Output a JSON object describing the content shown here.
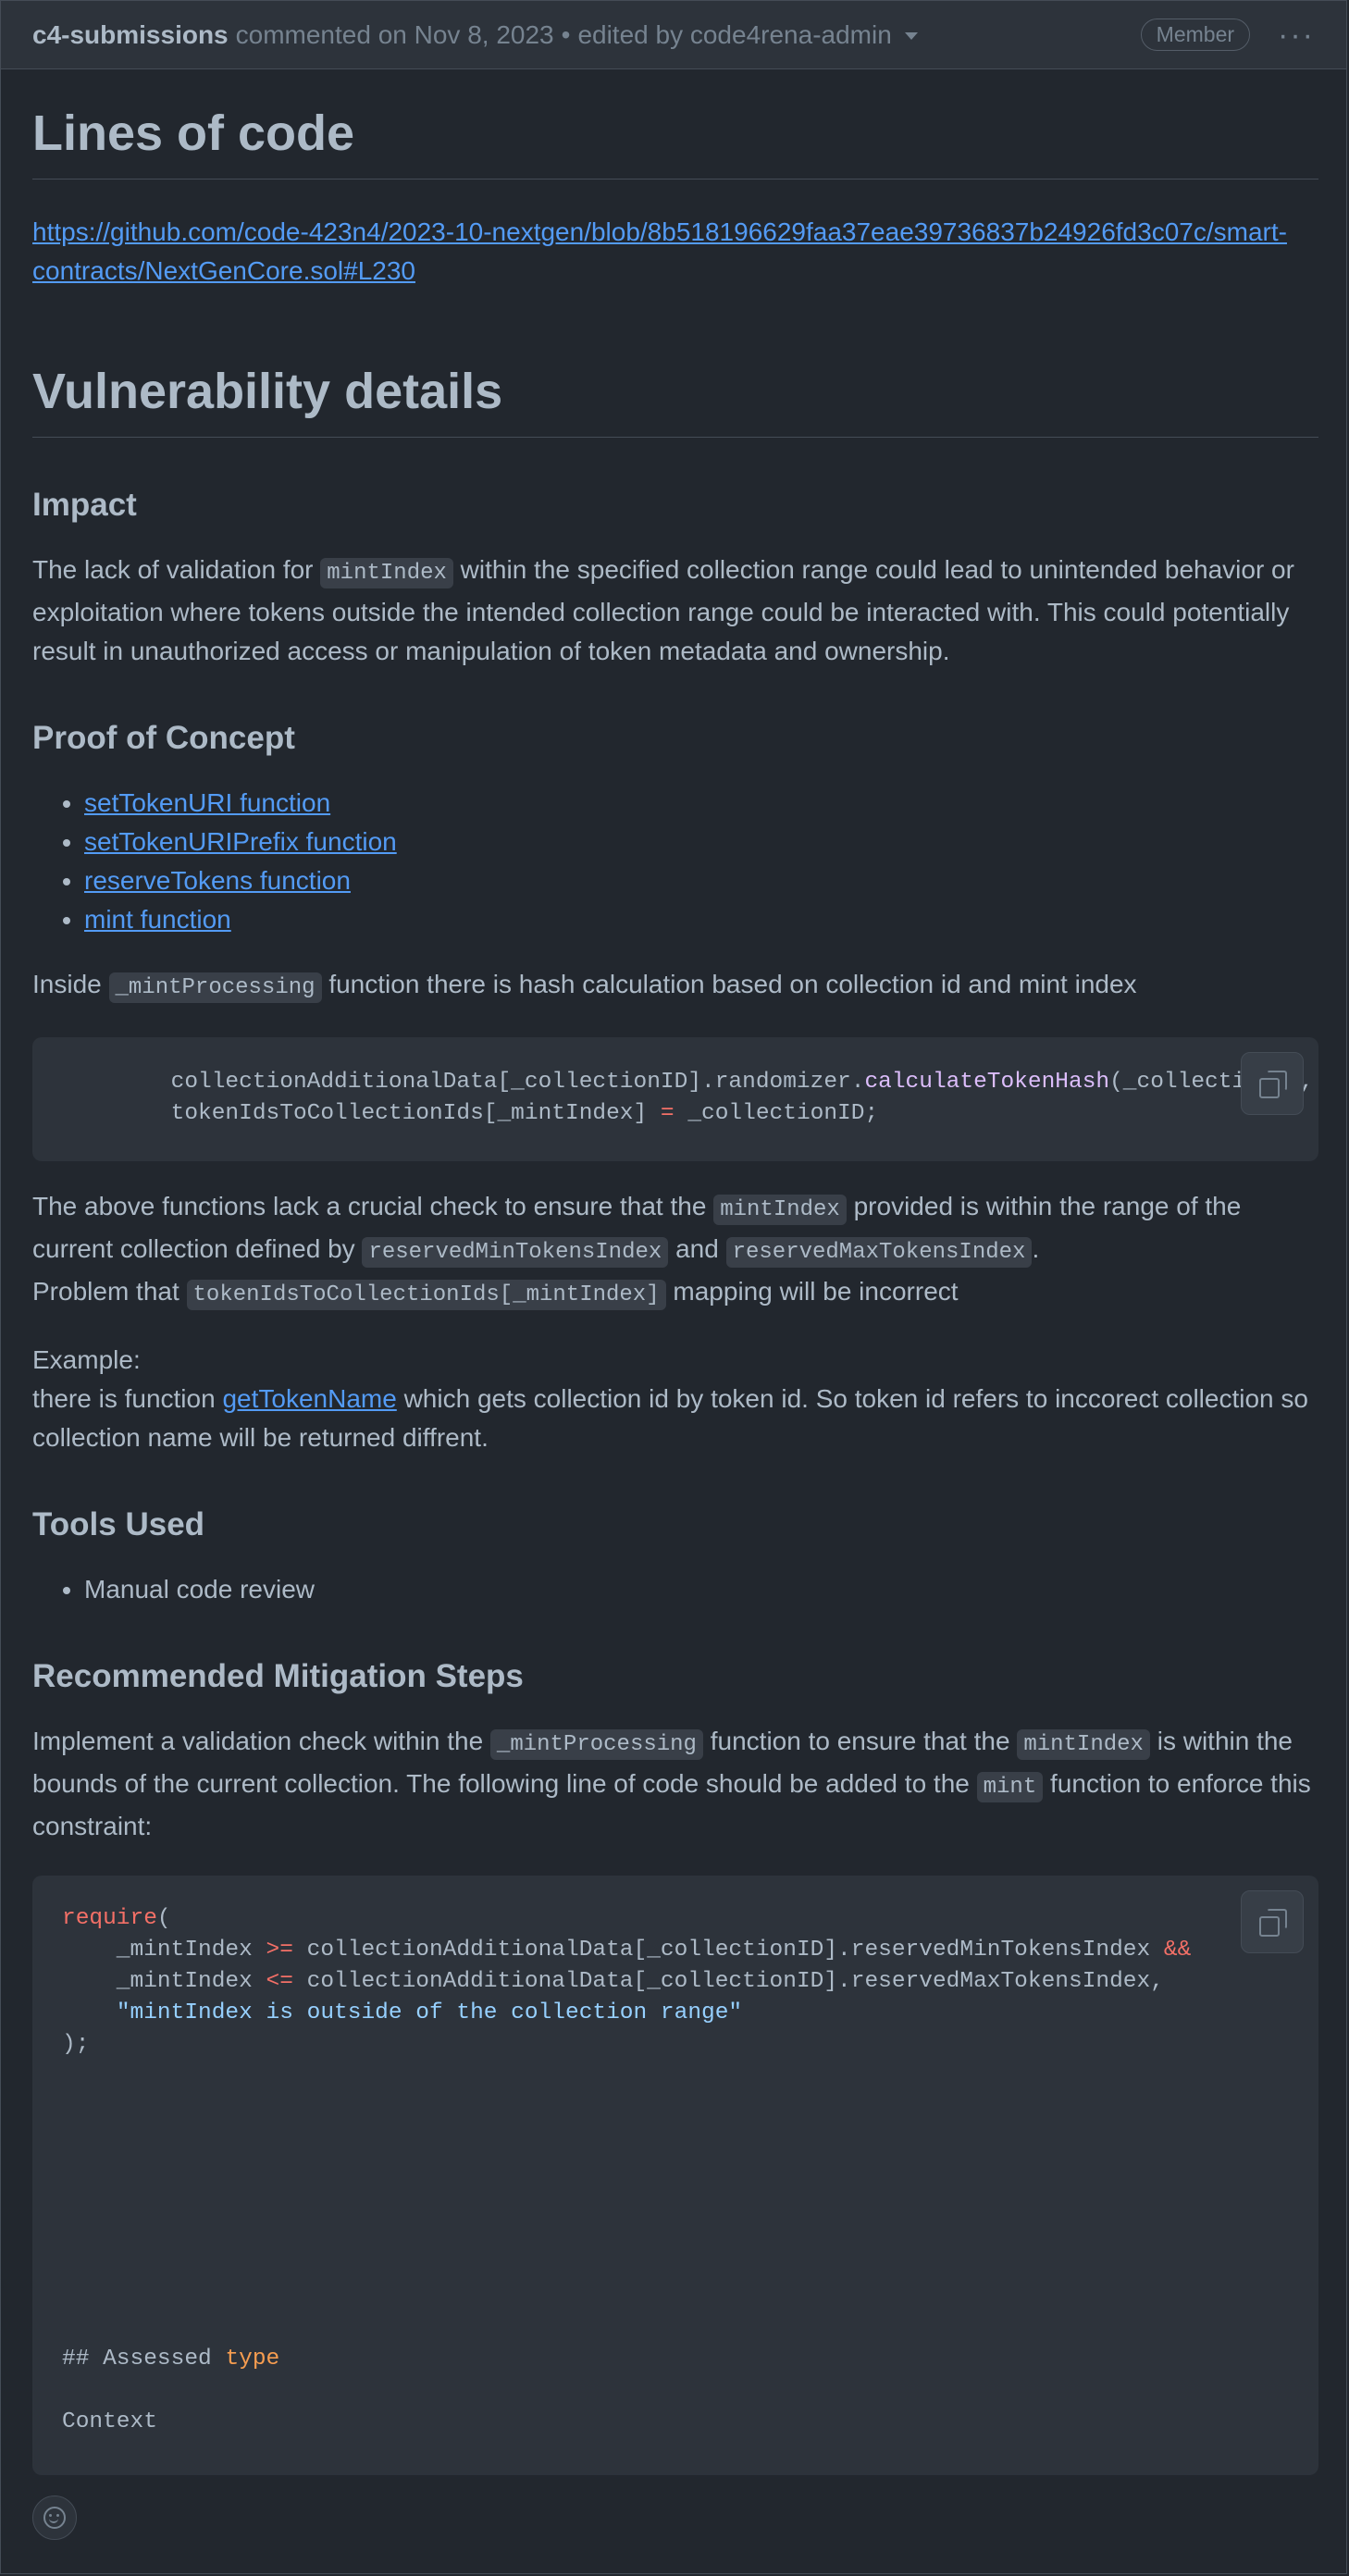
{
  "header": {
    "author": "c4-submissions",
    "commented": "commented on Nov 8, 2023",
    "bullet": "•",
    "edited": "edited by code4rena-admin",
    "role_badge": "Member",
    "more_menu": "···"
  },
  "sections": {
    "loc_title": "Lines of code",
    "loc_link": "https://github.com/code-423n4/2023-10-nextgen/blob/8b518196629faa37eae39736837b24926fd3c07c/smart-contracts/NextGenCore.sol#L230",
    "vuln_title": "Vulnerability details",
    "impact_title": "Impact",
    "impact": {
      "t1": "The lack of validation for ",
      "c1": "mintIndex",
      "t2": " within the specified collection range could lead to unintended behavior or exploitation where tokens outside the intended collection range could be interacted with. This could potentially result in unauthorized access or manipulation of token metadata and ownership."
    },
    "poc_title": "Proof of Concept",
    "poc_links": [
      "setTokenURI function",
      "setTokenURIPrefix function",
      "reserveTokens function",
      "mint function"
    ],
    "inside": {
      "t1": "Inside ",
      "c1": "_mintProcessing",
      "t2": " function there is hash calculation based on collection id and mint index"
    },
    "code1": {
      "l1_indent": "        ",
      "l1_a": "collectionAdditionalData[_collectionID].randomizer.",
      "l1_fn": "calculateTokenHash",
      "l1_b": "(_collectionID, _mintIndex, _saltfun_o);",
      "l2_indent": "        ",
      "l2_a": "tokenIdsToCollectionIds[_mintIndex] ",
      "l2_op": "=",
      "l2_b": " _collectionID;"
    },
    "lack": {
      "t1": "The above functions lack a crucial check to ensure that the ",
      "c1": "mintIndex",
      "t2": " provided is within the range of the current collection defined by ",
      "c2": "reservedMinTokensIndex",
      "t3": " and ",
      "c3": "reservedMaxTokensIndex",
      "t4": ".",
      "t5": "Problem that ",
      "c4": "tokenIdsToCollectionIds[_mintIndex]",
      "t6": " mapping will be incorrect"
    },
    "example": {
      "label": "Example:",
      "t1": "there is function ",
      "link": "getTokenName",
      "t2": " which gets collection id by token id. So token id refers to inccorect collection so collection name will be returned diffrent."
    },
    "tools_title": "Tools Used",
    "tools_items": [
      "Manual code review"
    ],
    "mitigation_title": "Recommended Mitigation Steps",
    "mitigation": {
      "t1": "Implement a validation check within the ",
      "c1": "_mintProcessing",
      "t2": " function to ensure that the ",
      "c2": "mintIndex",
      "t3": " is within the bounds of the current collection. The following line of code should be added to the ",
      "c3": "mint",
      "t4": " function to enforce this constraint:"
    },
    "code2": {
      "l1_kw": "require",
      "l1_b": "(",
      "l2_a": "    _mintIndex ",
      "l2_op": ">=",
      "l2_b": " collectionAdditionalData[_collectionID].reservedMinTokensIndex ",
      "l2_op2": "&&",
      "l3_a": "    _mintIndex ",
      "l3_op": "<=",
      "l3_b": " collectionAdditionalData[_collectionID].reservedMaxTokensIndex,",
      "l4_indent": "    ",
      "l4_str": "\"mintIndex is outside of the collection range\"",
      "l5": ");",
      "blank": " ",
      "l6_a": "## Assessed ",
      "l6_kw": "type",
      "l7": "Context"
    }
  },
  "icons": {
    "copy": "copy-icon",
    "reaction": "smiley-icon",
    "dropdown": "triangle-down-icon"
  },
  "colors": {
    "background": "#22272e",
    "header_bg": "#2d333b",
    "link": "#539bf5",
    "code_keyword": "#f47067",
    "code_function": "#dcbdfb",
    "code_string": "#96d0ff",
    "code_type": "#f69d50"
  }
}
